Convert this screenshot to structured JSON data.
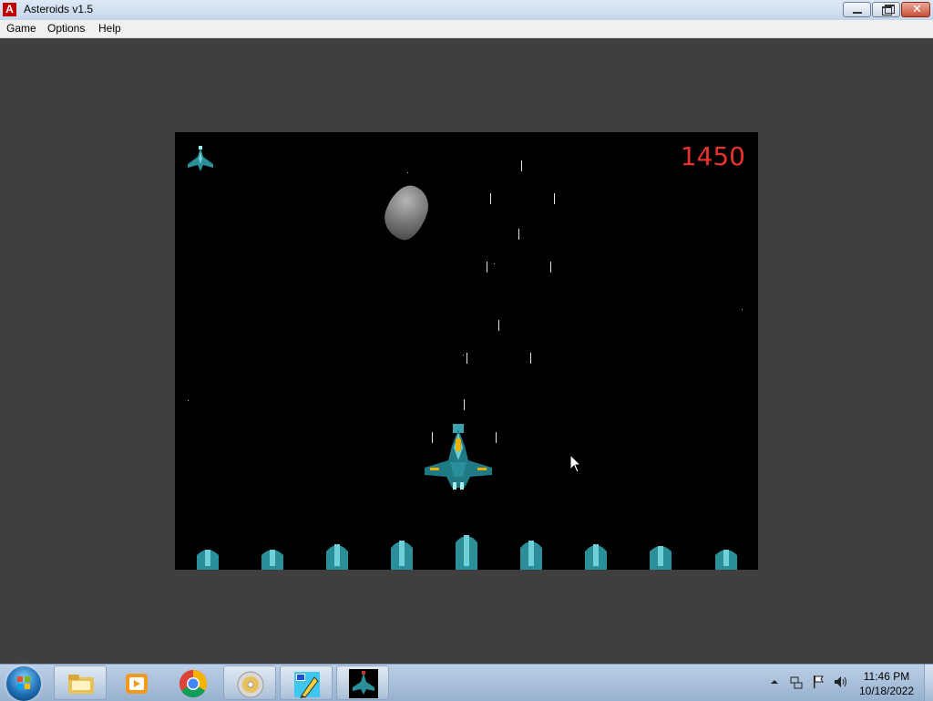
{
  "window": {
    "title": "Asteroids v1.5",
    "app_icon_letter": "A"
  },
  "menu": {
    "items": [
      "Game",
      "Options",
      "Help"
    ]
  },
  "game": {
    "score": "1450",
    "lives_remaining": 1,
    "colors": {
      "background": "#000000",
      "score": "#e8322b"
    }
  },
  "taskbar": {
    "pinned": [
      "windows-explorer-icon",
      "media-player-icon",
      "chrome-icon",
      "dvd-icon",
      "paint-icon",
      "asteroids-icon"
    ],
    "clock": {
      "time": "11:46 PM",
      "date": "10/18/2022"
    }
  }
}
